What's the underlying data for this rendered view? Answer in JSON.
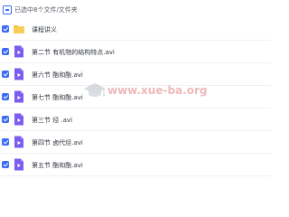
{
  "header": {
    "selection_text": "已选中8个文件/文件夹"
  },
  "items": [
    {
      "type": "folder",
      "icon": "folder-icon",
      "label": "课程讲义"
    },
    {
      "type": "video",
      "icon": "video-file-icon",
      "label": "第二节 有机物的结构特点.avi"
    },
    {
      "type": "video",
      "icon": "video-file-icon",
      "label": "第六节 酯和酯.avi"
    },
    {
      "type": "video",
      "icon": "video-file-icon",
      "label": "第七节 酯和酯.avi"
    },
    {
      "type": "video",
      "icon": "video-file-icon",
      "label": "第三节 烃 .avi"
    },
    {
      "type": "video",
      "icon": "video-file-icon",
      "label": "第四节 卤代烃.avi"
    },
    {
      "type": "video",
      "icon": "video-file-icon",
      "label": "第五节 酯和酯.avi"
    }
  ],
  "watermark": {
    "text": "www.xue-ba.org"
  },
  "colors": {
    "accent": "#3b6cf6",
    "folder": "#f5c443",
    "video": "#7b5cf0",
    "watermark": "#e9a8a8"
  }
}
